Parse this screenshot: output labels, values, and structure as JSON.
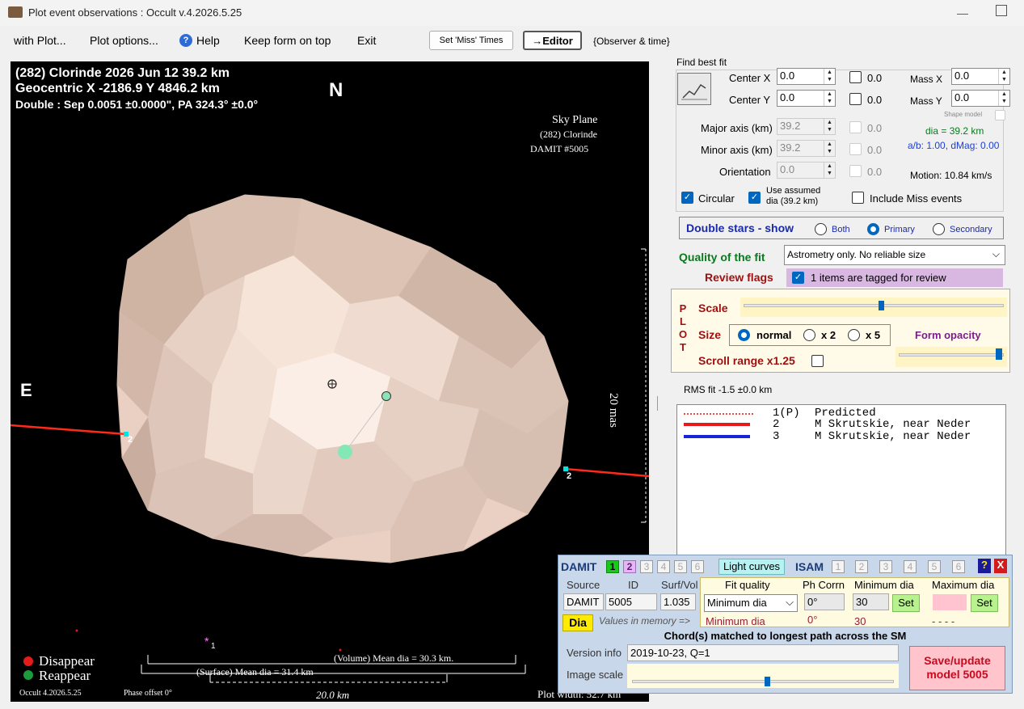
{
  "window": {
    "title": "Plot event observations : Occult v.4.2026.5.25",
    "minimize": "—"
  },
  "menu": {
    "with_plot": "with Plot...",
    "plot_options": "Plot options...",
    "help": "Help",
    "keep_on_top": "Keep form on top",
    "exit": "Exit",
    "set_miss_times": "Set 'Miss' Times",
    "editor": "→Editor",
    "observer_time": "{Observer & time}"
  },
  "plot": {
    "header_line1": "(282) Clorinde  2026 Jun 12   39.2 km",
    "header_line2": "Geocentric  X  -2186.9  Y 4846.2 km",
    "header_line3": "Double : Sep  0.0051 ±0.0000\", PA 324.3° ±0.0°",
    "north": "N",
    "east": "E",
    "sky_plane": "Sky Plane",
    "sky_object": "(282) Clorinde",
    "damit_id": "DAMIT #5005",
    "scale_mas": "20 mas",
    "chord_label_left": "2",
    "chord_label_right": "2",
    "star_label": "1",
    "disappear": "Disappear",
    "reappear": "Reappear",
    "volume_dia": "(Volume) Mean dia = 30.3 km.",
    "surface_dia": "(Surface) Mean dia = 31.4 km",
    "scale_km": "20.0 km",
    "version": "Occult 4.2026.5.25",
    "phase_offset": "Phase offset 0°",
    "plot_width": "Plot width: 52.7 km",
    "colors": {
      "disappear": "#e51b1b",
      "reappear": "#1d9a3c",
      "chord": "#ff2a1a",
      "marker": "#00e5e5"
    }
  },
  "fit": {
    "find_best_fit": "Find best fit",
    "center_x_label": "Center X",
    "center_x": "0.0",
    "center_x_err": "0.0",
    "center_y_label": "Center Y",
    "center_y": "0.0",
    "center_y_err": "0.0",
    "mass_x_label": "Mass X",
    "mass_x": "0.0",
    "mass_y_label": "Mass Y",
    "mass_y": "0.0",
    "shape_model": "Shape model",
    "major_axis_label": "Major axis (km)",
    "major_axis": "39.2",
    "major_axis_err": "0.0",
    "minor_axis_label": "Minor axis (km)",
    "minor_axis": "39.2",
    "minor_axis_err": "0.0",
    "orientation_label": "Orientation",
    "orientation": "0.0",
    "orientation_err": "0.0",
    "dia": "dia = 39.2 km",
    "ab_dmag": "a/b: 1.00, dMag: 0.00",
    "motion": "Motion: 10.84 km/s",
    "circular": "Circular",
    "use_assumed": "Use assumed",
    "use_assumed2": "dia (39.2 km)",
    "include_miss": "Include Miss events"
  },
  "double_stars": {
    "label": "Double stars - show",
    "both": "Both",
    "primary": "Primary",
    "secondary": "Secondary"
  },
  "quality": {
    "label": "Quality of the fit",
    "value": "Astrometry only. No reliable size",
    "review_label": "Review flags",
    "review_value": "1 items are tagged for review"
  },
  "plot_ctrl": {
    "plot_vertical": [
      "P",
      "L",
      "O",
      "T"
    ],
    "scale": "Scale",
    "size": "Size",
    "normal": "normal",
    "x2": "x 2",
    "x5": "x 5",
    "form_opacity": "Form opacity",
    "scroll_range": "Scroll range x1.25"
  },
  "rms": "RMS fit -1.5 ±0.0 km",
  "legend": [
    {
      "num": "1(P)",
      "text": "Predicted"
    },
    {
      "num": "2",
      "text": "M Skrutskie, near Neder"
    },
    {
      "num": "3",
      "text": "M Skrutskie, near Neder"
    }
  ],
  "damit": {
    "damit_label": "DAMIT",
    "damit_nums": [
      "1",
      "2",
      "3",
      "4",
      "5",
      "6"
    ],
    "light_curves": "Light curves",
    "isam_label": "ISAM",
    "isam_nums": [
      "1",
      "2",
      "3",
      "4",
      "5",
      "6"
    ],
    "help": "?",
    "close": "X",
    "source_hdr": "Source",
    "id_hdr": "ID",
    "surf_vol_hdr": "Surf/Vol",
    "fit_quality_hdr": "Fit quality",
    "ph_corr_hdr": "Ph Corrn",
    "min_dia_hdr": "Minimum dia",
    "max_dia_hdr": "Maximum dia",
    "source": "DAMIT",
    "id": "5005",
    "surf_vol": "1.035",
    "fit_quality": "Minimum dia",
    "ph_corr": "0°",
    "min_dia": "30",
    "set": "Set",
    "dia_btn": "Dia",
    "values_memory": "Values in memory =>",
    "mem_fit_quality": "Minimum dia",
    "mem_ph_corr": "0°",
    "mem_min_dia": "30",
    "mem_max_dia": "- - - -",
    "chords_matched": "Chord(s) matched to longest path across the SM",
    "version_label": "Version info",
    "version_value": "2019-10-23, Q=1",
    "image_scale": "Image scale",
    "save_btn_line1": "Save/update",
    "save_btn_line2": "model 5005"
  }
}
